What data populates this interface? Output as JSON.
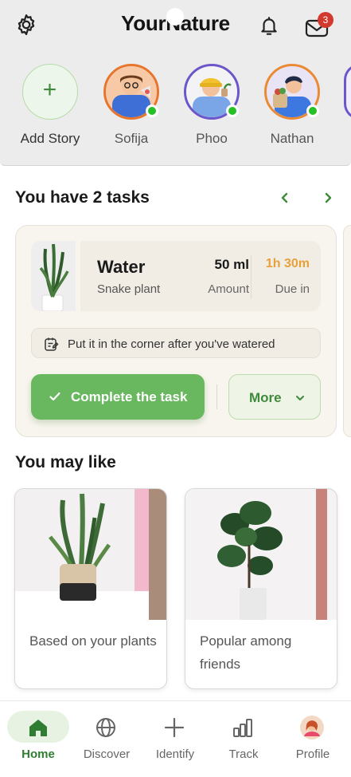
{
  "header": {
    "app_title": "YourNature",
    "mail_badge_count": "3",
    "icons": [
      "gear-icon",
      "bell-icon",
      "mail-icon"
    ]
  },
  "stories": {
    "add_label": "Add Story",
    "users": [
      {
        "name": "Sofija",
        "online": true
      },
      {
        "name": "Phoo",
        "online": true
      },
      {
        "name": "Nathan",
        "online": true
      }
    ]
  },
  "tasks": {
    "heading": "You have 2 tasks",
    "current": {
      "action": "Water",
      "plant": "Snake plant",
      "amount_value": "50 ml",
      "amount_label": "Amount",
      "due_value": "1h 30m",
      "due_label": "Due in",
      "note": "Put it in the corner after you've watered",
      "complete_label": "Complete the task",
      "more_label": "More"
    }
  },
  "recommendations": {
    "heading": "You may like",
    "cards": [
      {
        "label": "Based on your plants"
      },
      {
        "label": "Popular among friends"
      }
    ]
  },
  "nav": {
    "items": [
      {
        "label": "Home",
        "icon": "home-icon",
        "active": true
      },
      {
        "label": "Discover",
        "icon": "globe-icon",
        "active": false
      },
      {
        "label": "Identify",
        "icon": "plus-icon",
        "active": false
      },
      {
        "label": "Track",
        "icon": "bar-chart-icon",
        "active": false
      },
      {
        "label": "Profile",
        "icon": "avatar",
        "active": false
      }
    ]
  },
  "colors": {
    "accent_green": "#69b75f",
    "dark_green": "#2e7d32",
    "due_orange": "#e7a13a",
    "badge_red": "#d23a30",
    "online_green": "#25c025"
  }
}
